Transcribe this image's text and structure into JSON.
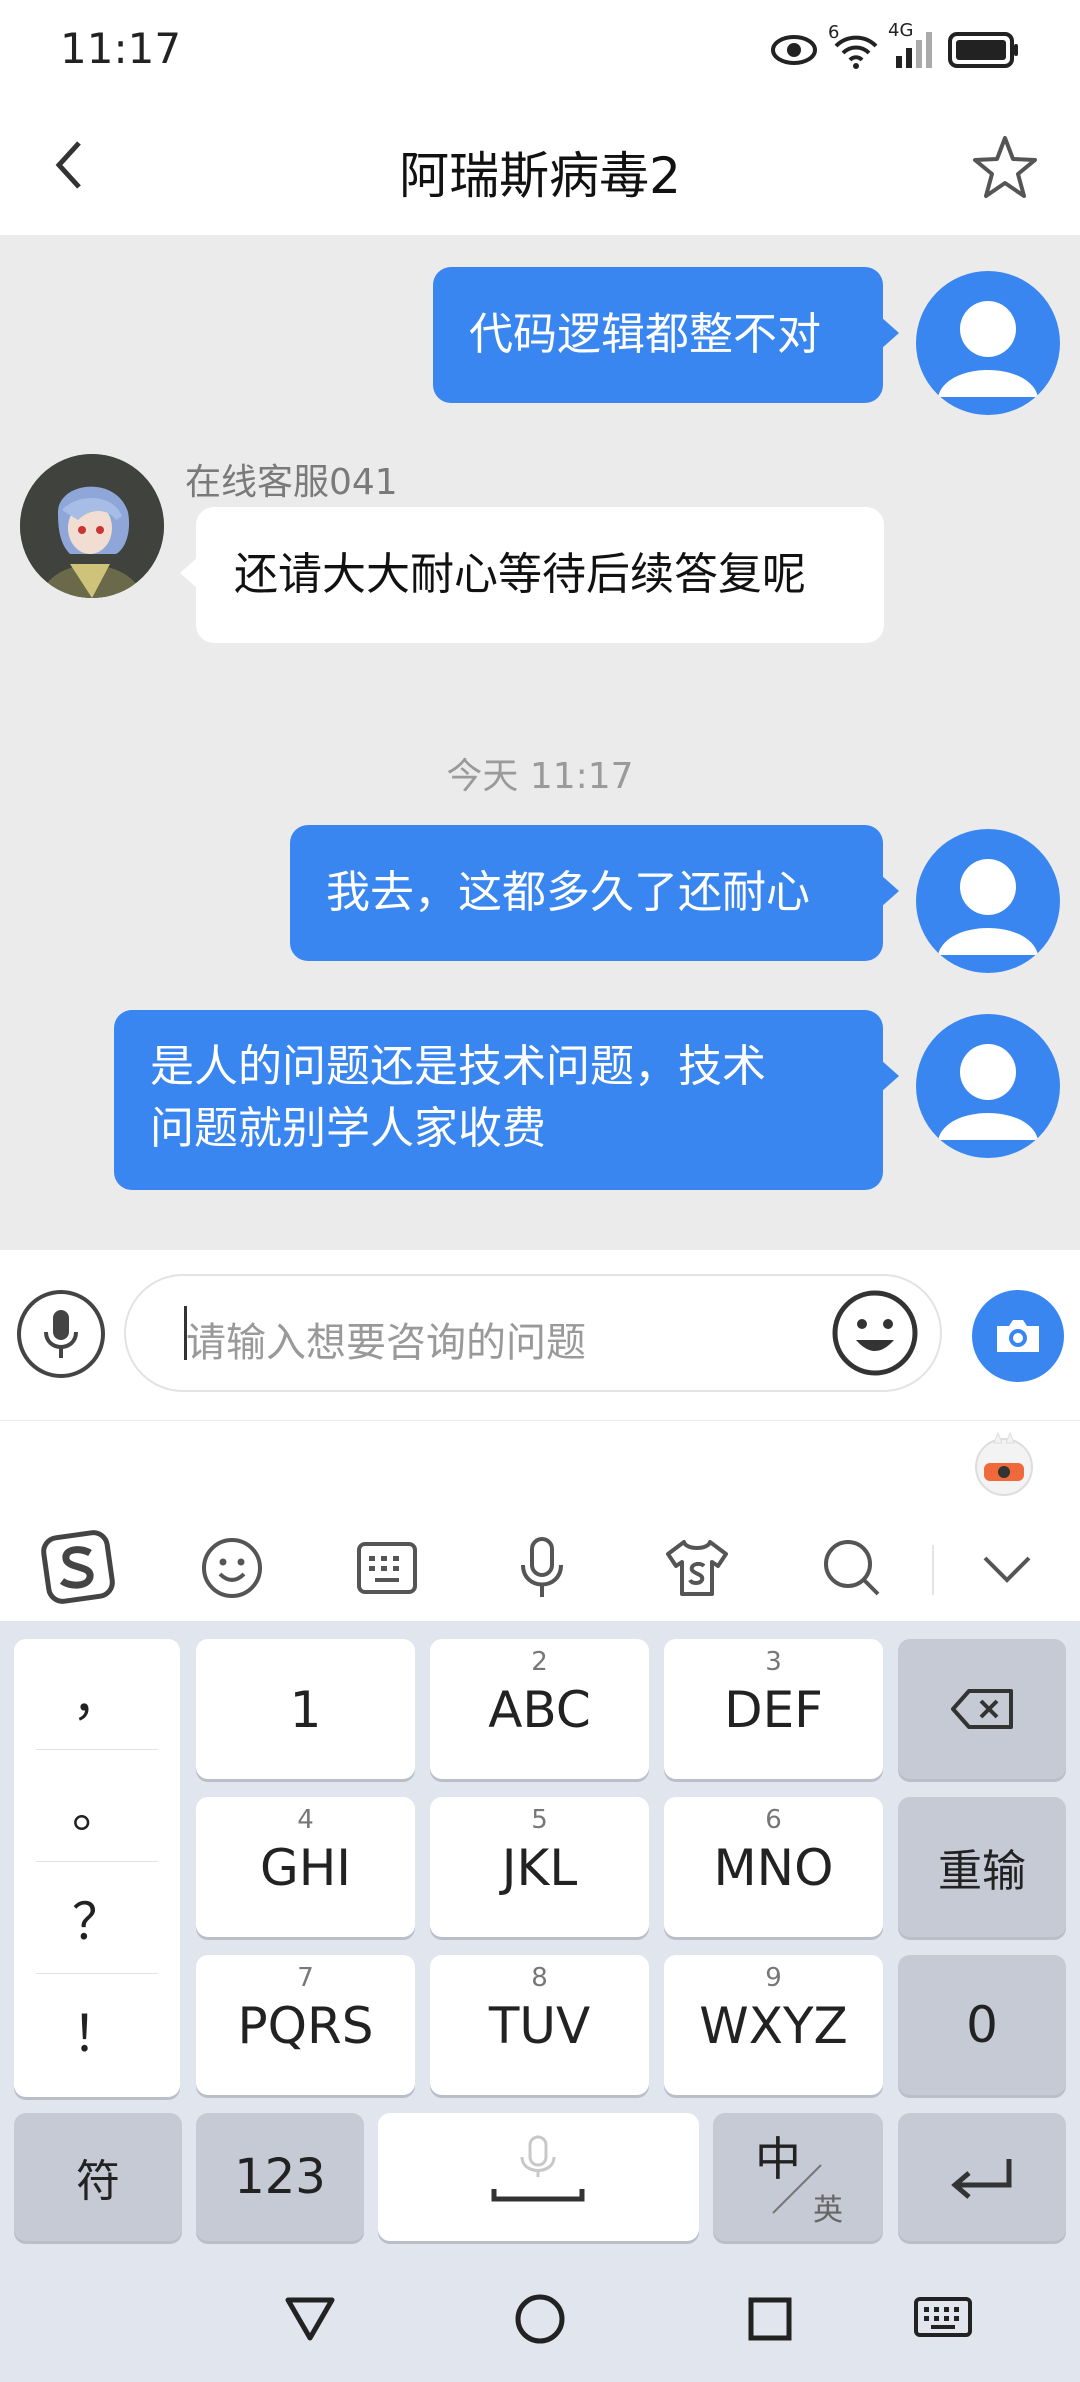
{
  "status_bar": {
    "time": "11:17",
    "signal_label": "4G",
    "wifi_label": "6"
  },
  "header": {
    "title": "阿瑞斯病毒2"
  },
  "chat": {
    "messages": [
      {
        "from": "me",
        "text": "代码逻辑都整不对"
      },
      {
        "from": "agent",
        "sender": "在线客服041",
        "text": "还请大大耐心等待后续答复呢"
      },
      {
        "from": "me",
        "text": "我去，这都多久了还耐心"
      },
      {
        "from": "me",
        "text_line1": "是人的问题还是技术问题，技术",
        "text_line2": "问题就别学人家收费"
      }
    ],
    "timestamp": "今天 11:17"
  },
  "input": {
    "placeholder": "请输入想要咨询的问题"
  },
  "keyboard": {
    "punctuation": [
      "，",
      "。",
      "？",
      "！"
    ],
    "keys": [
      {
        "num": "",
        "label": "1"
      },
      {
        "num": "2",
        "label": "ABC"
      },
      {
        "num": "3",
        "label": "DEF"
      },
      {
        "num": "4",
        "label": "GHI"
      },
      {
        "num": "5",
        "label": "JKL"
      },
      {
        "num": "6",
        "label": "MNO"
      },
      {
        "num": "7",
        "label": "PQRS"
      },
      {
        "num": "8",
        "label": "TUV"
      },
      {
        "num": "9",
        "label": "WXYZ"
      }
    ],
    "reinput": "重输",
    "zero": "0",
    "symbols": "符",
    "numeric": "123",
    "lang_main": "中",
    "lang_alt": "英"
  },
  "colors": {
    "accent": "#3a86f0",
    "chat_bg": "#ebebeb",
    "keyboard_bg": "#e1e5ee"
  },
  "icons": [
    "back-icon",
    "star-icon",
    "mic-icon",
    "emoji-icon",
    "camera-icon",
    "sogou-logo-icon",
    "smiley-icon",
    "keyboard-icon",
    "voice-icon",
    "tshirt-icon",
    "search-icon",
    "chevron-down-icon",
    "backspace-icon",
    "enter-icon",
    "nav-back-icon",
    "nav-home-icon",
    "nav-recent-icon",
    "nav-keyboard-icon"
  ]
}
